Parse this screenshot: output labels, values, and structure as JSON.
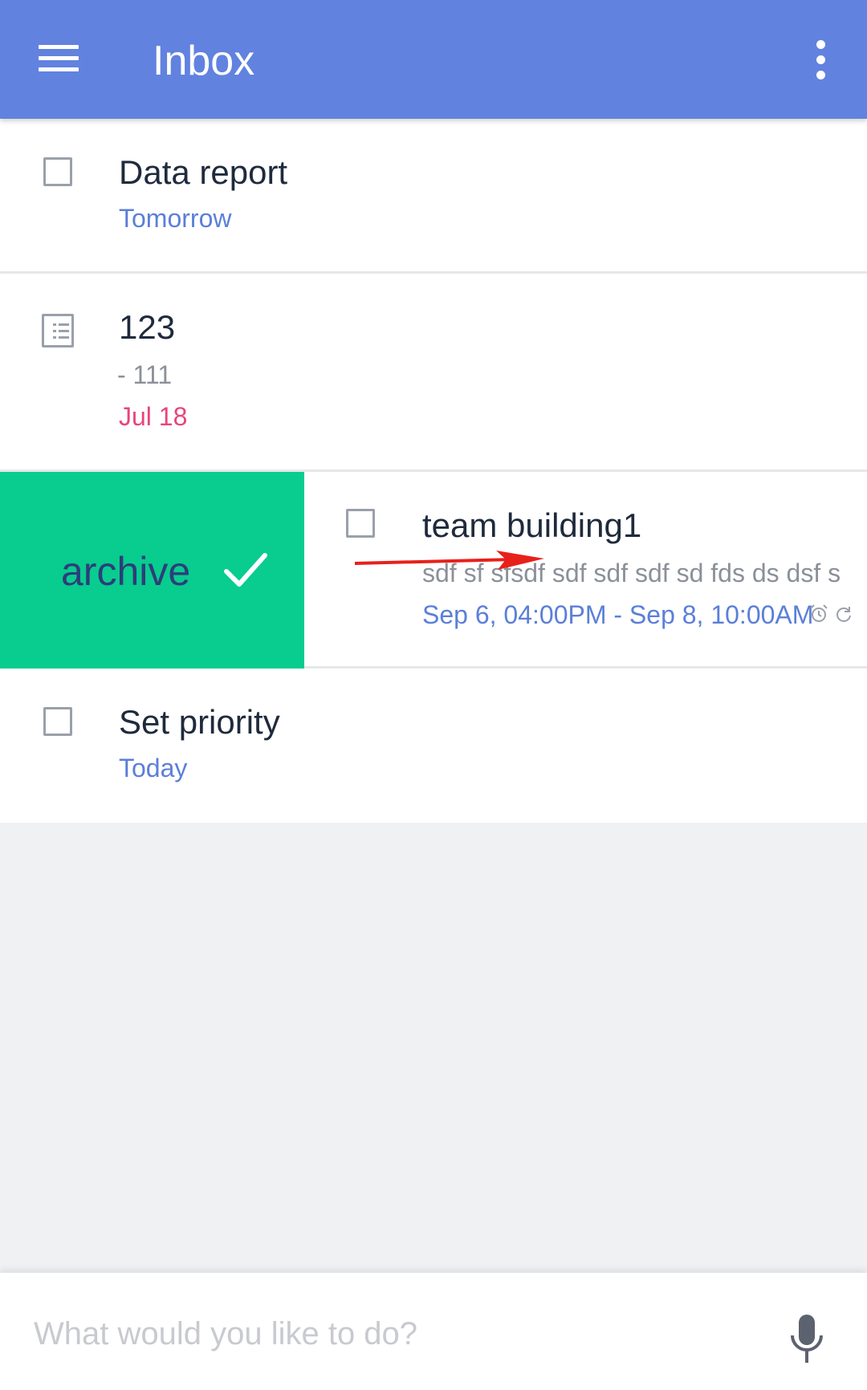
{
  "appbar": {
    "title": "Inbox",
    "background": "#6182df",
    "left_icon": "menu-icon",
    "right_icon": "more-vert-icon"
  },
  "tasks": [
    {
      "title": "Data report",
      "date": "Tomorrow",
      "date_color": "#5b7fd9",
      "icon": "checkbox"
    },
    {
      "title": "123",
      "note": "- 111",
      "date": "Jul 18",
      "date_color": "#e8457a",
      "icon": "note-icon"
    },
    {
      "title": "team building1",
      "note": "sdf sf sfsdf sdf sdf sdf sd fds ds dsf s",
      "date": "Sep 6, 04:00PM - Sep 8, 10:00AM",
      "date_color": "#5b7fd9",
      "icon": "checkbox",
      "extra_icons": [
        "alarm-icon",
        "repeat-icon"
      ]
    },
    {
      "title": "Set priority",
      "date": "Today",
      "date_color": "#5b7fd9",
      "icon": "checkbox"
    }
  ],
  "swipe_action": {
    "label": "archive",
    "background": "#09cc8f",
    "icon": "check-icon"
  },
  "annotation": {
    "icon": "red-arrow",
    "color": "#e8201b"
  },
  "composer": {
    "placeholder": "What would you like to do?",
    "icon": "mic-icon"
  }
}
